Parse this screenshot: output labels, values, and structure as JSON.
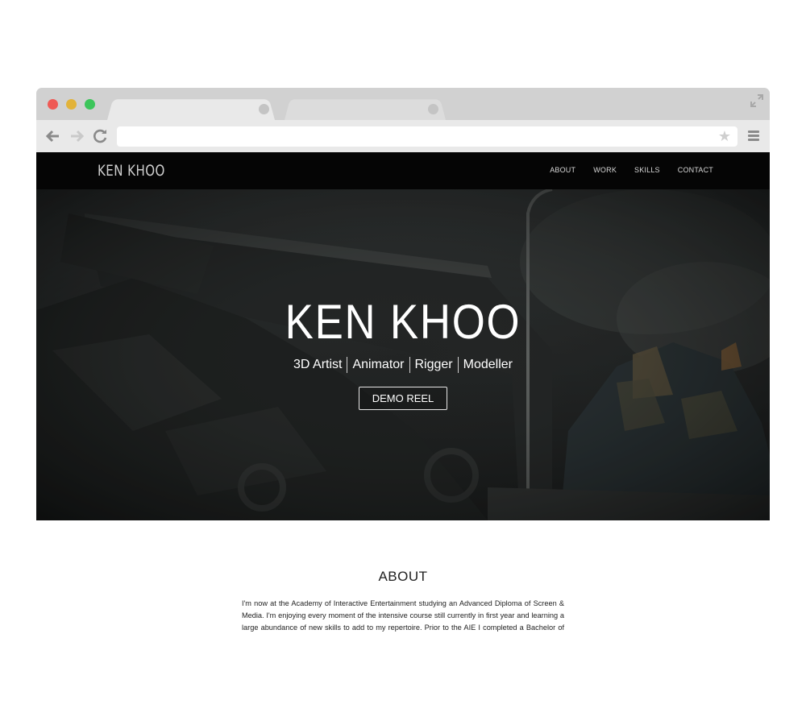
{
  "browser": {
    "icons": {
      "back": "arrow-left-icon",
      "forward": "arrow-right-icon",
      "reload": "reload-icon",
      "bookmark": "star-icon",
      "menu": "hamburger-menu-icon",
      "fullscreen": "expand-icon"
    },
    "traffic_light_colors": [
      "#ef5a55",
      "#e2b33a",
      "#3cc55a"
    ],
    "url": ""
  },
  "site": {
    "brand": "KEN KHOO",
    "menu": [
      {
        "label": "ABOUT"
      },
      {
        "label": "WORK"
      },
      {
        "label": "SKILLS"
      },
      {
        "label": "CONTACT"
      }
    ],
    "hero": {
      "title": "KEN KHOO",
      "roles": [
        "3D Artist",
        "Animator",
        "Rigger",
        "Modeller"
      ],
      "button": "DEMO REEL"
    },
    "about": {
      "heading": "ABOUT",
      "text": "I'm now at the Academy of Interactive Entertainment studying an Advanced Diploma of Screen & Media. I'm enjoying every moment of the intensive course still currently in first year and learning a large abundance of new skills to add to my repertoire. Prior to the AIE I completed a Bachelor of Design Computing degree at the University of Sydney, where I discovered my passion"
    }
  }
}
